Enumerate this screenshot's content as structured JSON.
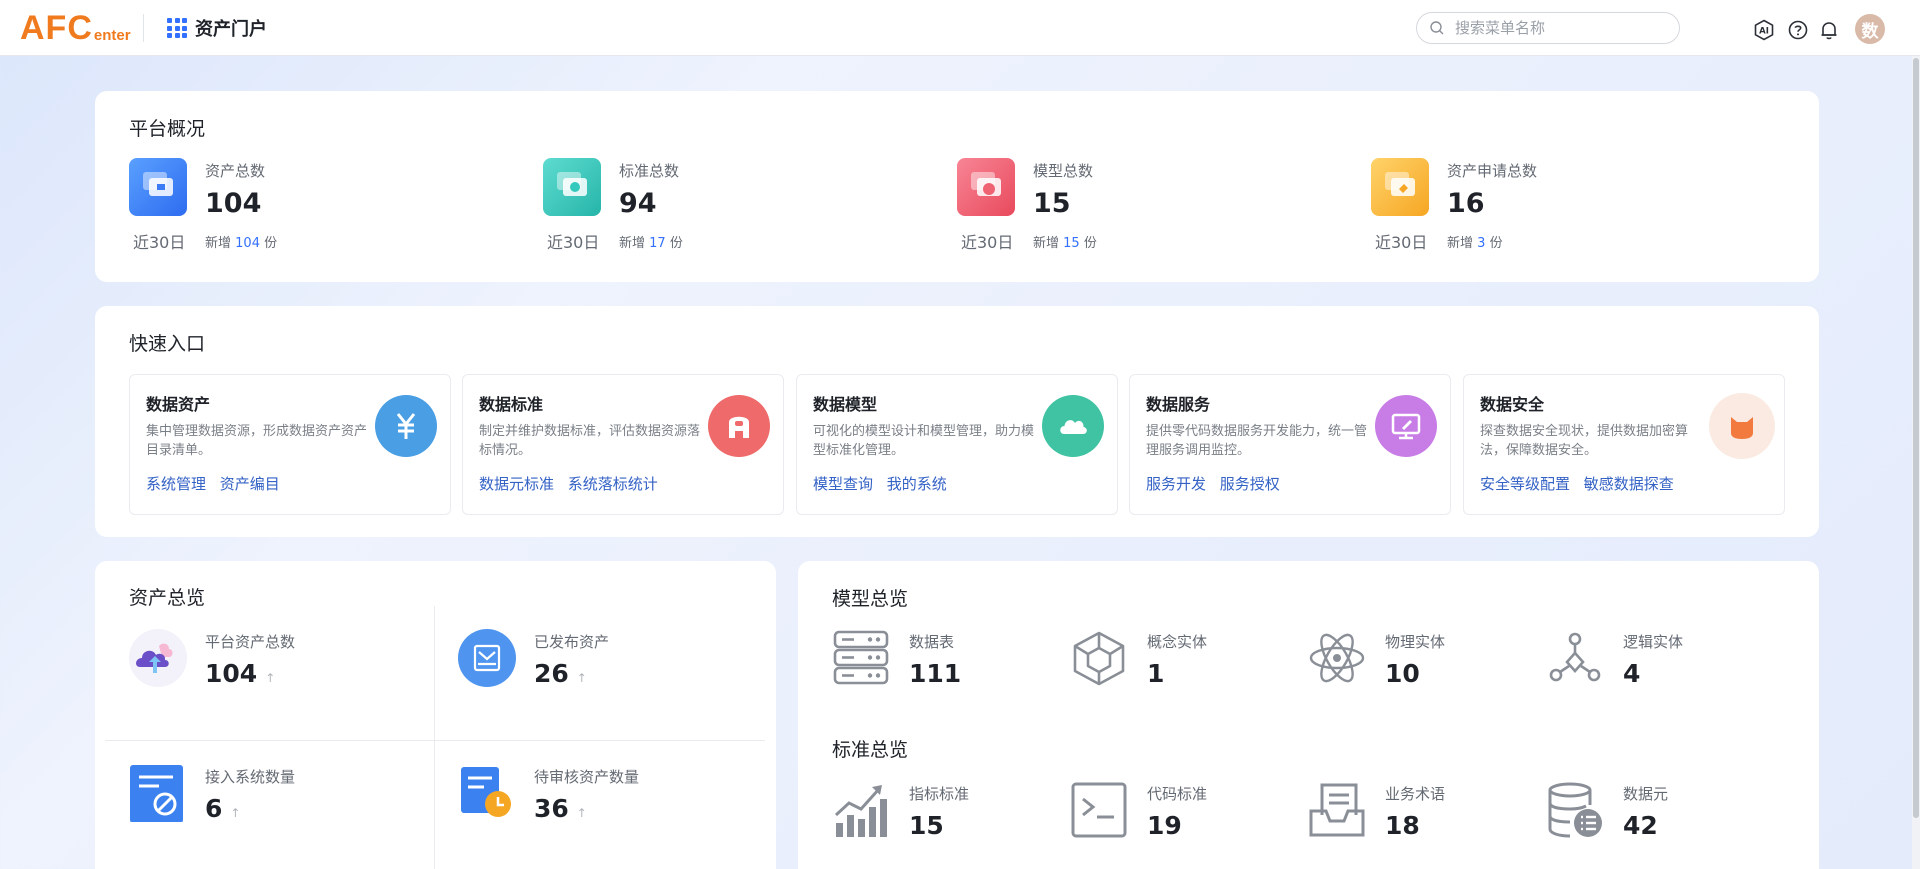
{
  "header": {
    "logo_main": "AFC",
    "logo_sub": "enter",
    "portal_title": "资产门户",
    "search_placeholder": "搜索菜单名称",
    "avatar_text": "数",
    "icons": [
      "ai-icon",
      "help-icon",
      "bell-icon"
    ]
  },
  "platform_overview": {
    "title": "平台概况",
    "items": [
      {
        "label": "资产总数",
        "value": "104",
        "period": "近30日",
        "new_prefix": "新增",
        "new_count": "104",
        "new_suffix": "份",
        "color": "#3b7cf6"
      },
      {
        "label": "标准总数",
        "value": "94",
        "period": "近30日",
        "new_prefix": "新增",
        "new_count": "17",
        "new_suffix": "份",
        "color": "#35c9bd"
      },
      {
        "label": "模型总数",
        "value": "15",
        "period": "近30日",
        "new_prefix": "新增",
        "new_count": "15",
        "new_suffix": "份",
        "color": "#ef6272"
      },
      {
        "label": "资产申请总数",
        "value": "16",
        "period": "近30日",
        "new_prefix": "新增",
        "new_count": "3",
        "new_suffix": "份",
        "color": "#fbbd3a"
      }
    ]
  },
  "quick_entry": {
    "title": "快速入口",
    "cards": [
      {
        "title": "数据资产",
        "desc": "集中管理数据资源，形成数据资产资产目录清单。",
        "links": [
          "系统管理",
          "资产编目"
        ],
        "icon": "yuan-icon",
        "color": "#4a9ee3"
      },
      {
        "title": "数据标准",
        "desc": "制定并维护数据标准，评估数据资源落标情况。",
        "links": [
          "数据元标准",
          "系统落标统计"
        ],
        "icon": "standard-a-icon",
        "color": "#ef6a6a"
      },
      {
        "title": "数据模型",
        "desc": "可视化的模型设计和模型管理，助力模型标准化管理。",
        "links": [
          "模型查询",
          "我的系统"
        ],
        "icon": "cloud-icon",
        "color": "#3fc3a2"
      },
      {
        "title": "数据服务",
        "desc": "提供零代码数据服务开发能力，统一管理服务调用监控。",
        "links": [
          "服务开发",
          "服务授权"
        ],
        "icon": "monitor-icon",
        "color": "#c77ce6"
      },
      {
        "title": "数据安全",
        "desc": "探查数据安全现状，提供数据加密算法，保障数据安全。",
        "links": [
          "安全等级配置",
          "敏感数据探查"
        ],
        "icon": "cat-shield-icon",
        "color": "#fbeae2"
      }
    ]
  },
  "asset_overview": {
    "title": "资产总览",
    "items": [
      {
        "label": "平台资产总数",
        "value": "104",
        "arrow": "↑",
        "icon": "cloud-upload-icon"
      },
      {
        "label": "已发布资产",
        "value": "26",
        "arrow": "↑",
        "icon": "inbox-icon"
      },
      {
        "label": "接入系统数量",
        "value": "6",
        "arrow": "↑",
        "icon": "system-access-icon"
      },
      {
        "label": "待审核资产数量",
        "value": "36",
        "arrow": "↑",
        "icon": "pending-review-icon"
      }
    ]
  },
  "model_overview": {
    "title": "模型总览",
    "items": [
      {
        "label": "数据表",
        "value": "111",
        "icon": "server-icon"
      },
      {
        "label": "概念实体",
        "value": "1",
        "icon": "cube-icon"
      },
      {
        "label": "物理实体",
        "value": "10",
        "icon": "atom-icon"
      },
      {
        "label": "逻辑实体",
        "value": "4",
        "icon": "network-icon"
      }
    ]
  },
  "standard_overview": {
    "title": "标准总览",
    "items": [
      {
        "label": "指标标准",
        "value": "15",
        "icon": "trend-chart-icon"
      },
      {
        "label": "代码标准",
        "value": "19",
        "icon": "terminal-icon"
      },
      {
        "label": "业务术语",
        "value": "18",
        "icon": "document-tray-icon"
      },
      {
        "label": "数据元",
        "value": "42",
        "icon": "database-list-icon"
      }
    ]
  }
}
